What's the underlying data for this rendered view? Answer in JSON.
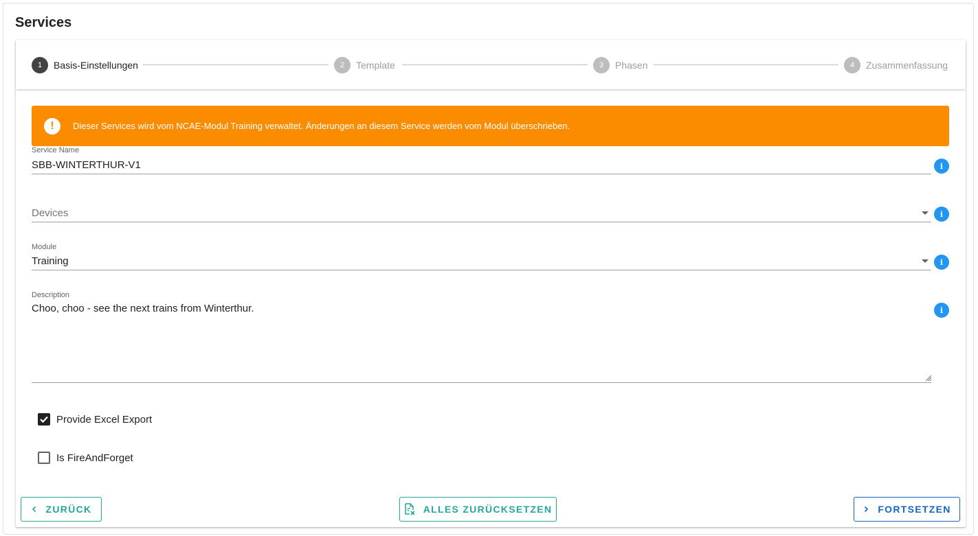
{
  "page": {
    "title": "Services"
  },
  "stepper": {
    "steps": [
      {
        "number": "1",
        "label": "Basis-Einstellungen",
        "active": true
      },
      {
        "number": "2",
        "label": "Template",
        "active": false
      },
      {
        "number": "3",
        "label": "Phasen",
        "active": false
      },
      {
        "number": "4",
        "label": "Zusammenfassung",
        "active": false
      }
    ]
  },
  "alert": {
    "icon": "exclamation-circle-icon",
    "text": "Dieser Services wird vom NCAE-Modul Training verwaltet. Änderungen an diesem Service werden vom Modul überschrieben.",
    "color": "#fb8c00"
  },
  "form": {
    "service_name": {
      "label": "Service Name",
      "value": "SBB-WINTERTHUR-V1"
    },
    "devices": {
      "placeholder": "Devices",
      "value": ""
    },
    "module": {
      "label": "Module",
      "value": "Training"
    },
    "description": {
      "label": "Description",
      "value": "Choo, choo - see the next trains from Winterthur."
    },
    "excel_export": {
      "label": "Provide Excel Export",
      "checked": true
    },
    "fire_and_forget": {
      "label": "Is FireAndForget",
      "checked": false
    }
  },
  "actions": {
    "back": "ZURÜCK",
    "reset": "ALLES ZURÜCKSETZEN",
    "next": "FORTSETZEN"
  },
  "colors": {
    "accent_teal": "#26a69a",
    "primary_blue": "#1565c0",
    "info_blue": "#2196f3"
  }
}
